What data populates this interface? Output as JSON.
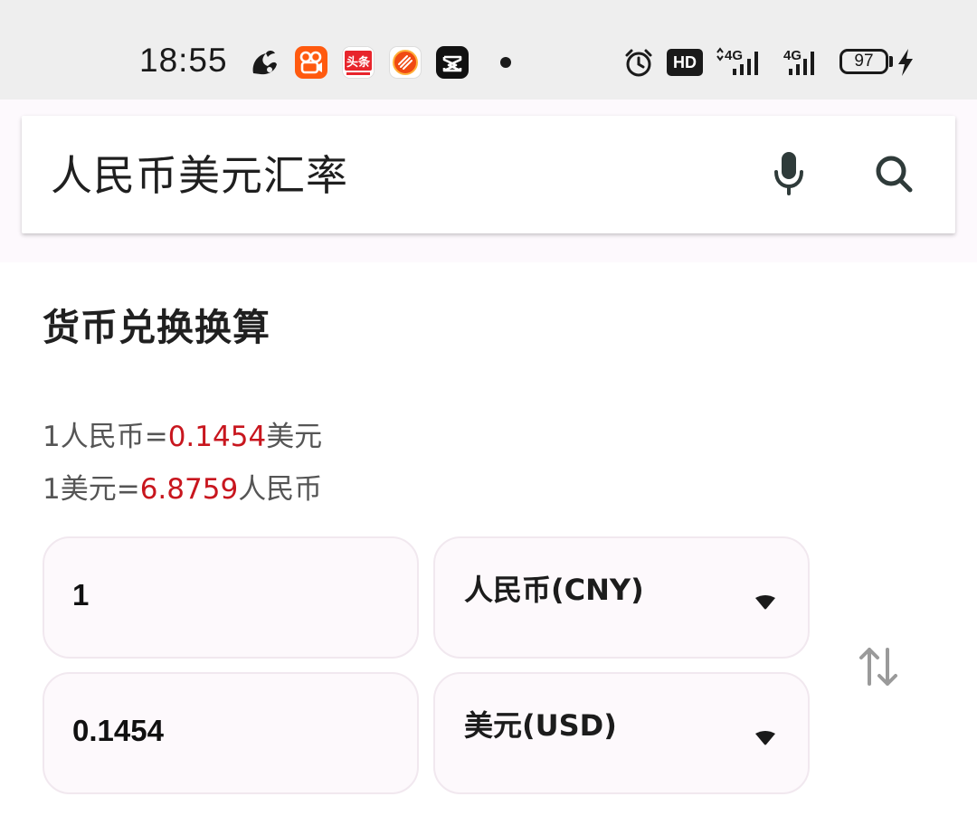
{
  "status_bar": {
    "time": "18:55",
    "toutiao_label": "头条",
    "hd_label": "HD",
    "network_1": "4G",
    "network_2": "4G",
    "battery_level": "97"
  },
  "search": {
    "query": "人民币美元汇率",
    "mic_icon": "mic-icon",
    "search_icon": "search-icon"
  },
  "converter": {
    "title": "货币兑换换算",
    "rate1": {
      "prefix": "1人民币=",
      "value": "0.1454",
      "suffix": "美元"
    },
    "rate2": {
      "prefix": "1美元=",
      "value": "6.8759",
      "suffix": "人民币"
    },
    "from": {
      "amount": "1",
      "currency": "人民币(CNY)"
    },
    "to": {
      "amount": "0.1454",
      "currency": "美元(USD)"
    },
    "swap_icon": "swap-vertical-icon"
  },
  "colors": {
    "accent_red": "#c8161e",
    "field_bg": "#fdf9fc",
    "status_bg": "#eeeeee"
  }
}
